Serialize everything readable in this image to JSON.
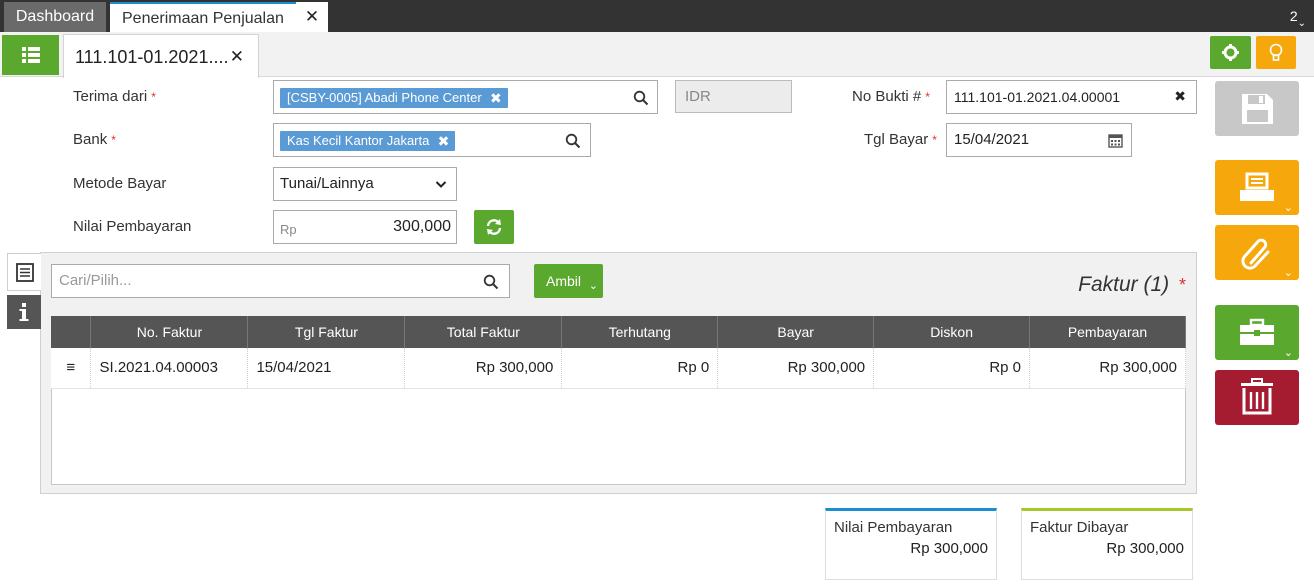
{
  "tabs": {
    "dashboard": "Dashboard",
    "active": "Penerimaan Penjualan",
    "count": "2"
  },
  "document_tab": {
    "label": "111.101-01.2021...."
  },
  "form": {
    "terima_dari": {
      "label": "Terima dari",
      "required": "*",
      "tag": "[CSBY-0005] Abadi Phone Center"
    },
    "currency": "IDR",
    "bank": {
      "label": "Bank",
      "required": "*",
      "tag": "Kas Kecil Kantor Jakarta"
    },
    "metode_bayar": {
      "label": "Metode Bayar",
      "selected": "Tunai/Lainnya"
    },
    "nilai_pembayaran": {
      "label": "Nilai Pembayaran",
      "prefix": "Rp",
      "value": "300,000"
    },
    "no_bukti": {
      "label": "No Bukti #",
      "required": "*",
      "value": "111.101-01.2021.04.00001"
    },
    "tgl_bayar": {
      "label": "Tgl Bayar",
      "required": "*",
      "value": "15/04/2021"
    }
  },
  "panel": {
    "search_placeholder": "Cari/Pilih...",
    "ambil_label": "Ambil",
    "title": "Faktur (1)",
    "title_required": "*"
  },
  "table": {
    "headers": [
      "No. Faktur",
      "Tgl Faktur",
      "Total Faktur",
      "Terhutang",
      "Bayar",
      "Diskon",
      "Pembayaran"
    ],
    "rows": [
      [
        "SI.2021.04.00003",
        "15/04/2021",
        "Rp 300,000",
        "Rp 0",
        "Rp 300,000",
        "Rp 0",
        "Rp 300,000"
      ]
    ]
  },
  "totals": {
    "nilai_pembayaran": {
      "label": "Nilai Pembayaran",
      "value": "Rp 300,000"
    },
    "faktur_dibayar": {
      "label": "Faktur Dibayar",
      "value": "Rp 300,000"
    }
  },
  "colors": {
    "green": "#5aa82e",
    "orange": "#f5a70c",
    "red": "#a51c30",
    "gray_save": "#c8c8c8",
    "tag_blue": "#5b9bd5",
    "accent_blue": "#1a8fd0",
    "accent_lime": "#a8c72a"
  },
  "icons": [
    "list-icon",
    "close-icon",
    "gear-icon",
    "bulb-icon",
    "search-icon",
    "calendar-icon",
    "refresh-icon",
    "document-icon",
    "info-icon",
    "save-icon",
    "print-icon",
    "paperclip-icon",
    "briefcase-icon",
    "trash-icon",
    "drag-handle-icon",
    "chevron-down-icon"
  ]
}
